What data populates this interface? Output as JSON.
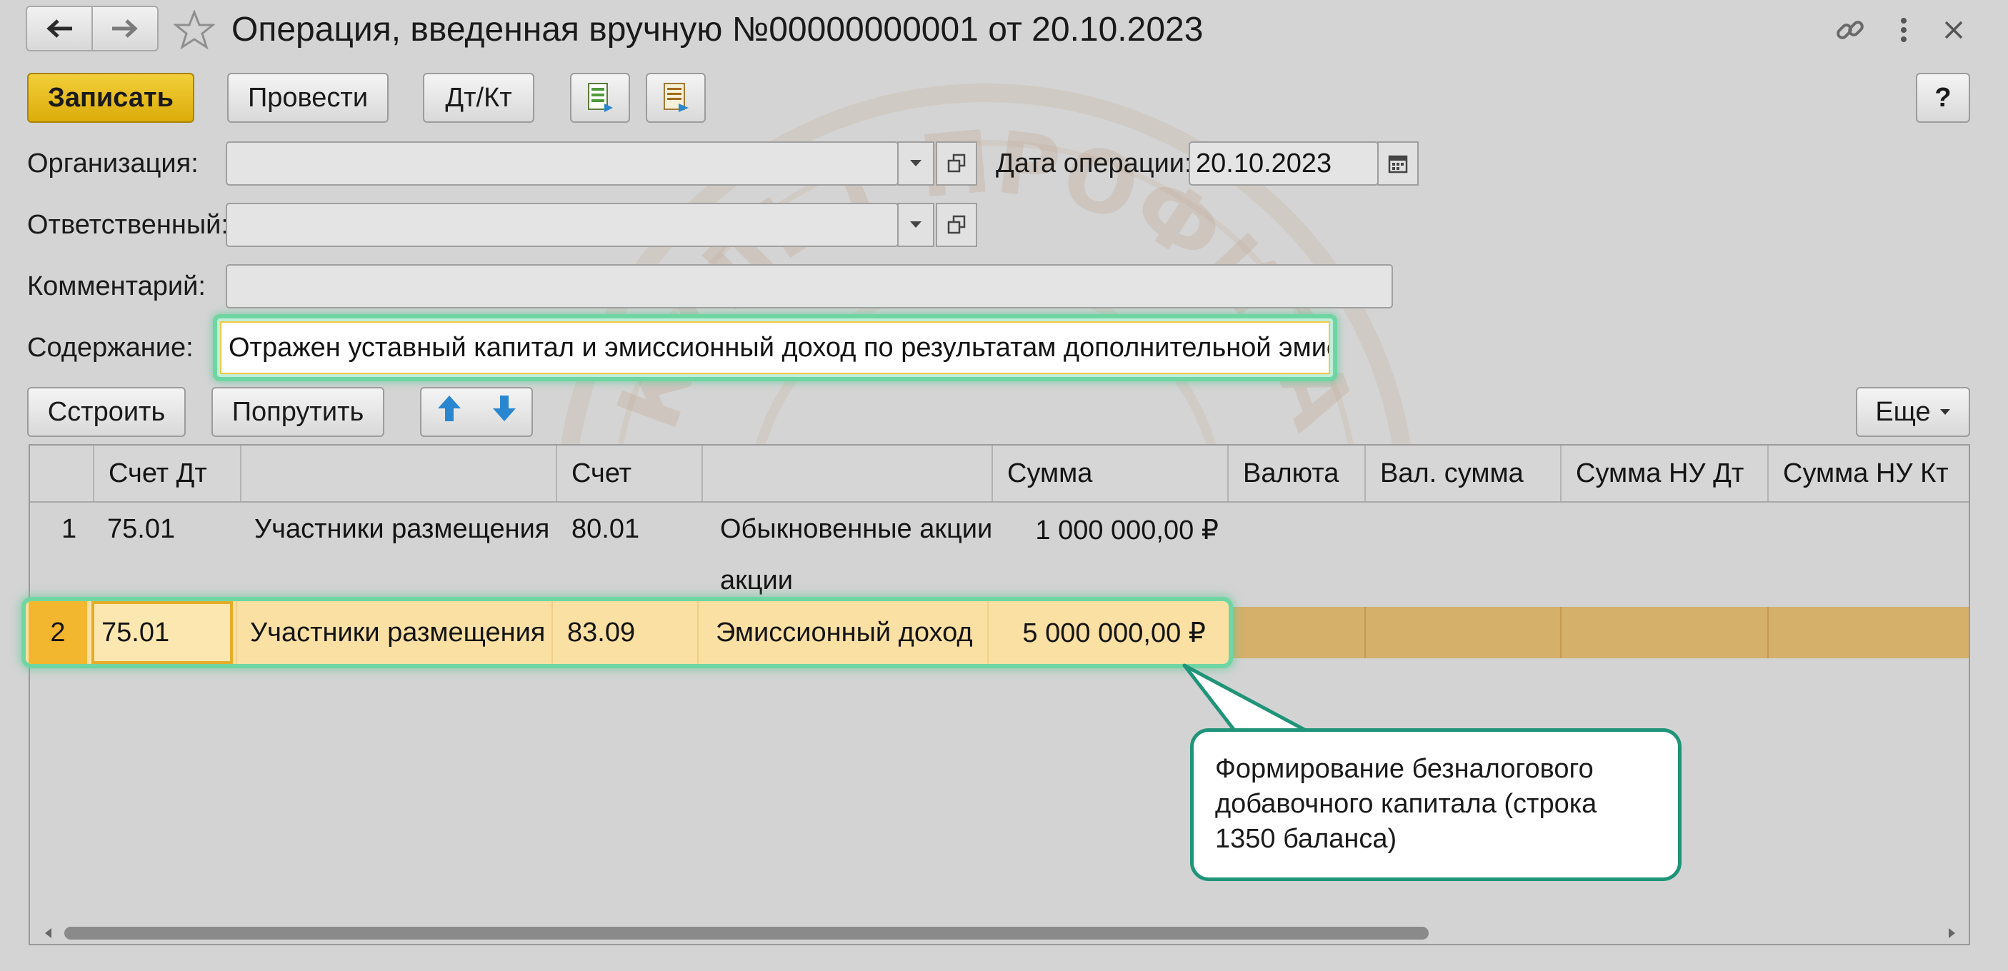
{
  "window": {
    "title": "Операция, введенная вручную №00000000001 от 20.10.2023"
  },
  "toolbar": {
    "save_label": "Записать",
    "post_label": "Провести",
    "dtkt_label": "Дт/Кт",
    "help_label": "?"
  },
  "form": {
    "organization_label": "Организация:",
    "organization_value": "",
    "date_label": "Дата операции:",
    "date_value": "20.10.2023",
    "responsible_label": "Ответственный:",
    "responsible_value": "",
    "comment_label": "Комментарий:",
    "comment_value": "",
    "content_label": "Содержание:",
    "content_value": "Отражен уставный капитал и эмиссионный доход по результатам дополнительной эмиссии"
  },
  "table_toolbar": {
    "build_label": "Сстроить",
    "fill_label": "Попрутить",
    "more_label": "Еще"
  },
  "table": {
    "columns": [
      "",
      "Счет Дт",
      "",
      "Счет",
      "",
      "Сумма",
      "Валюта",
      "Вал. сумма",
      "Сумма НУ Дт",
      "Сумма НУ Кт"
    ],
    "rows": [
      {
        "n": "1",
        "debit": "75.01",
        "debit_sub": "Участники размещения",
        "credit": "80.01",
        "credit_sub": "Обыкновенные акции",
        "credit_sub_wrap": "акции",
        "sum": "1 000 000,00 ₽"
      },
      {
        "n": "2",
        "debit": "75.01",
        "debit_sub": "Участники размещения",
        "credit": "83.09",
        "credit_sub": "Эмиссионный доход",
        "sum": "5 000 000,00 ₽"
      }
    ]
  },
  "callout": {
    "text": "Формирование безналогового добавочного капитала (строка 1350 баланса)"
  },
  "watermark": {
    "top_text": "КУЛЬТ ПРОФИТА",
    "bottom_text": "KULTPROFITA"
  },
  "colors": {
    "primary_button": "#e3b716",
    "selected_row": "#d4b06b",
    "highlight": "#6fd6a3",
    "callout_border": "#1f9478",
    "arrow_blue": "#2a86cf"
  },
  "icons": {
    "back": "arrow-left-icon",
    "forward": "arrow-right-icon",
    "favorite": "star-icon",
    "link": "link-icon",
    "menu": "more-vertical-icon",
    "close": "close-icon",
    "report1": "document-report-icon",
    "report2": "structure-report-icon",
    "open": "open-form-icon",
    "calendar": "calendar-icon",
    "move_up": "arrow-up-icon",
    "move_down": "arrow-down-icon"
  }
}
